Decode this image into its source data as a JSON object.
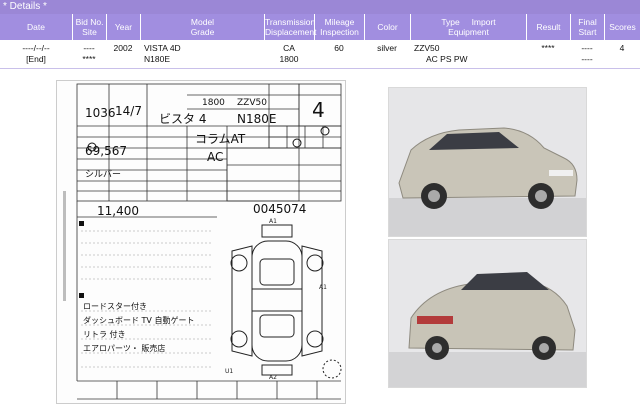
{
  "details": {
    "title": "* Details *"
  },
  "table": {
    "headers": [
      {
        "l1": "Date",
        "l2": ""
      },
      {
        "l1": "Bid No.",
        "l2": "Site"
      },
      {
        "l1": "Year",
        "l2": ""
      },
      {
        "l1": "Model",
        "l2": "Grade"
      },
      {
        "l1": "Transmission",
        "l2": "Displacement"
      },
      {
        "l1": "Mileage",
        "l2": "Inspection"
      },
      {
        "l1": "Color",
        "l2": ""
      },
      {
        "l1": "Type     Import",
        "l2": "Equipment"
      },
      {
        "l1": "Result",
        "l2": ""
      },
      {
        "l1": "Final",
        "l2": "Start"
      },
      {
        "l1": "Scores",
        "l2": ""
      }
    ],
    "row": {
      "date": "----/--/--",
      "end": "[End]",
      "bid_no": "----",
      "site": "****",
      "year": "2002",
      "model": "VISTA 4D",
      "grade": "N180E",
      "transmission": "CA",
      "displacement": "1800",
      "mileage": "60",
      "color": "silver",
      "type": "ZZV50",
      "equipment": "AC PS PW",
      "result": "****",
      "final": "----",
      "start": "----",
      "score": "4"
    }
  },
  "sheet": {
    "lot": "1036",
    "year_hw": "14/7",
    "model_hw": "ビスタ  4",
    "grade_hw": "N180E",
    "type_hw": "ZZV50",
    "displacement_hw": "1800",
    "color_hw": "シルバー",
    "mileage_hw": "69,567",
    "price_hw": "11,400",
    "chassis_hw": "0045074",
    "trans_hw": "コラムAT",
    "ac_hw": "AC",
    "notes": [
      "ロードスター付き",
      "ダッシュボード TV 自動ゲート",
      "リトラ 付き",
      "エアロパーツ・ 販売店"
    ],
    "grade_score_hw": "4",
    "mark_a1_top": "A1",
    "mark_a1_right": "A1",
    "mark_a2": "A2",
    "mark_u1": "U1"
  }
}
